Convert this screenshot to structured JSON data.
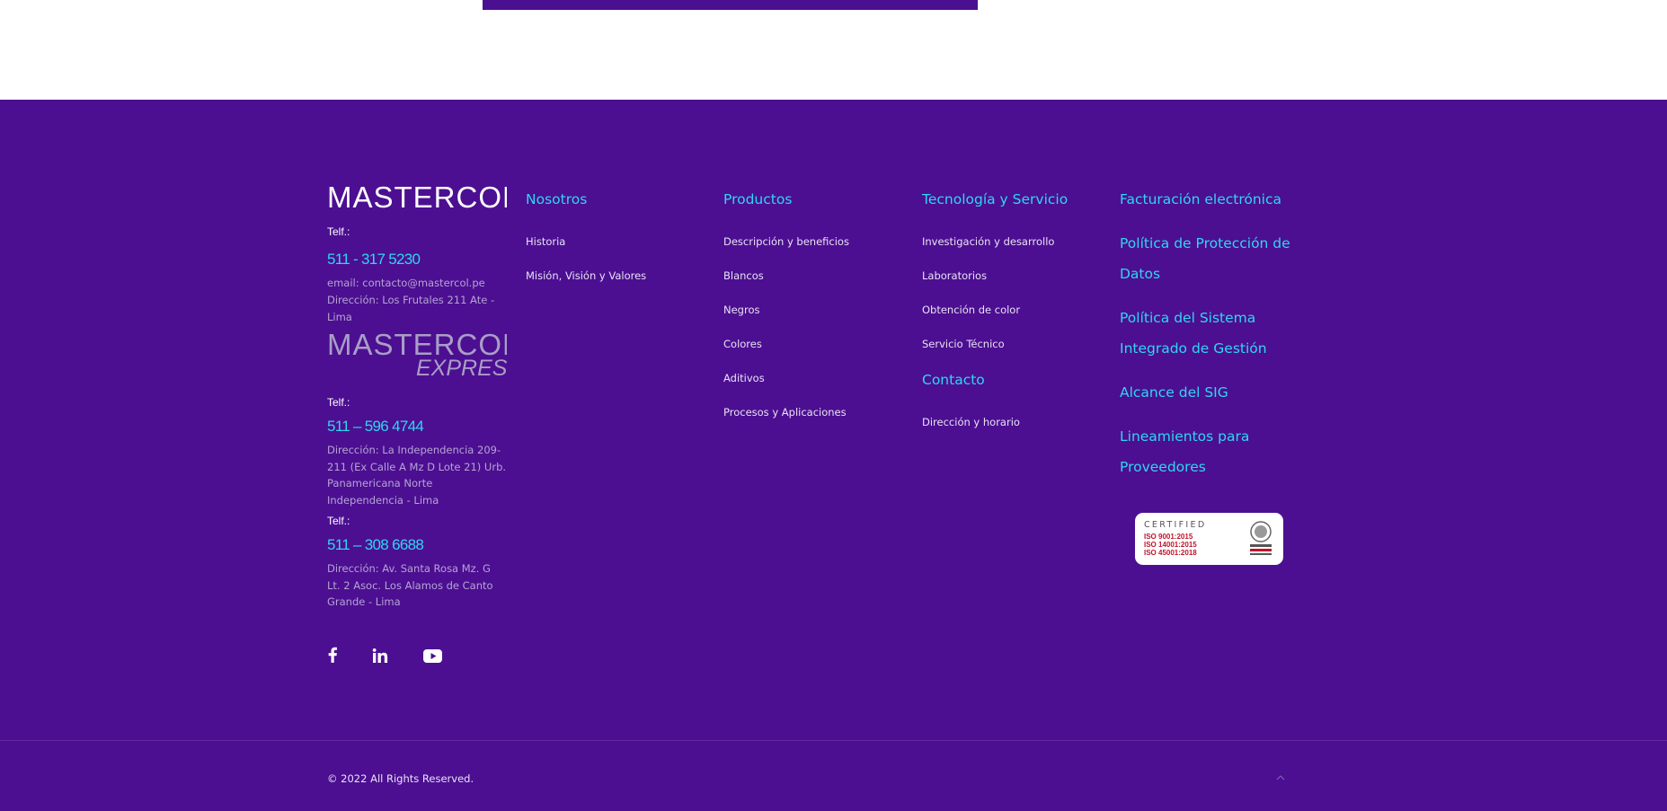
{
  "brand": {
    "logo_text": "MASTERCOL",
    "express_logo_text": "MASTERCOL",
    "express_sub": "EXPRESS"
  },
  "contact_blocks": [
    {
      "label": "Telf.:",
      "phone": "511 - 317 5230",
      "email": "email: contacto@mastercol.pe",
      "address": "Dirección: Los Frutales 211 Ate - Lima"
    },
    {
      "label": "Telf.:",
      "phone": "511 – 596 4744",
      "address": "Dirección: La Independencia 209-211 (Ex Calle A Mz D Lote 21) Urb. Panamericana Norte Independencia - Lima"
    },
    {
      "label": "Telf.:",
      "phone": "511 – 308 6688",
      "address": "Dirección: Av. Santa Rosa Mz. G Lt. 2 Asoc. Los Alamos de Canto Grande - Lima"
    }
  ],
  "social": [
    "facebook-icon",
    "linkedin-icon",
    "youtube-icon"
  ],
  "nosotros": {
    "heading": "Nosotros",
    "links": [
      "Historia",
      "Misión, Visión y Valores"
    ]
  },
  "productos": {
    "heading": "Productos",
    "links": [
      "Descripción y beneficios",
      "Blancos",
      "Negros",
      "Colores",
      "Aditivos",
      "Procesos y Aplicaciones"
    ]
  },
  "tecnologia": {
    "heading": "Tecnología y Servicio",
    "links": [
      "Investigación y desarrollo",
      "Laboratorios",
      "Obtención de color",
      "Servicio Técnico"
    ]
  },
  "contacto": {
    "heading": "Contacto",
    "links": [
      "Dirección y horario"
    ]
  },
  "legal": {
    "links": [
      "Facturación electrónica",
      "Política de Protección de Datos",
      "Política del Sistema Integrado de Gestión",
      "Alcance del SIG",
      "Lineamientos para Proveedores"
    ]
  },
  "certification": {
    "title": "CERTIFIED",
    "standards": [
      "ISO 9001:2015",
      "ISO 14001:2015",
      "ISO 45001:2018"
    ]
  },
  "copyright": "© 2022 All Rights Reserved.",
  "colors": {
    "footer_bg": "#4c0f91",
    "accent": "#2fd6f0",
    "top_bar": "#4b0f92"
  }
}
